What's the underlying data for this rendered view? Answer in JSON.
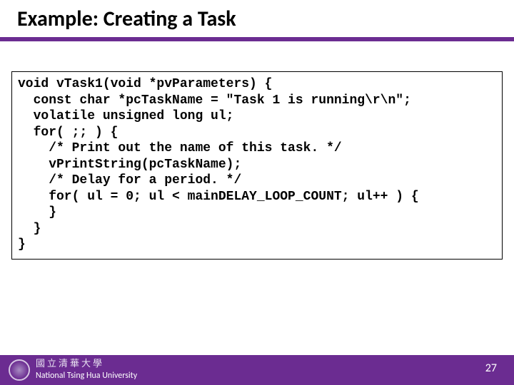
{
  "title": "Example: Creating a Task",
  "code_lines": [
    "void vTask1(void *pvParameters) {",
    "  const char *pcTaskName = \"Task 1 is running\\r\\n\";",
    "  volatile unsigned long ul;",
    "  for( ;; ) {",
    "    /* Print out the name of this task. */",
    "    vPrintString(pcTaskName);",
    "    /* Delay for a period. */",
    "    for( ul = 0; ul < mainDELAY_LOOP_COUNT; ul++ ) {",
    "    }",
    "  }",
    "}"
  ],
  "footer": {
    "uni_cn": "國立清華大學",
    "uni_en": "National Tsing Hua University",
    "page": "27"
  }
}
